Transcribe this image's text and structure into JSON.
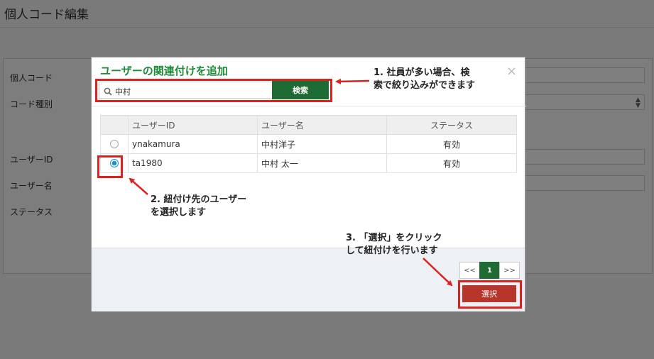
{
  "background": {
    "page_title": "個人コード編集",
    "labels": {
      "personal_code": "個人コード",
      "code_type": "コード種別",
      "user_id": "ユーザーID",
      "user_name": "ユーザー名",
      "status": "ステータス"
    }
  },
  "modal": {
    "title": "ユーザーの関連付けを追加",
    "close": "×",
    "search": {
      "value": "中村",
      "button_label": "検索"
    },
    "table": {
      "headers": [
        "",
        "ユーザーID",
        "ユーザー名",
        "ステータス"
      ],
      "rows": [
        {
          "user_id": "ynakamura",
          "user_name": "中村洋子",
          "status": "有効",
          "selected": false
        },
        {
          "user_id": "ta1980",
          "user_name": "中村 太一",
          "status": "有効",
          "selected": true
        }
      ]
    },
    "pager": {
      "prev": "<<",
      "current": "1",
      "next": ">>"
    },
    "select_button": "選択"
  },
  "annotations": {
    "note1_line1": "1. 社員が多い場合、検",
    "note1_line2": "索で絞り込みができます",
    "note2_line1": "2. 紐付け先のユーザー",
    "note2_line2": "を選択します",
    "note3_line1": "3. 「選択」をクリック",
    "note3_line2": "して紐付けを行います"
  },
  "colors": {
    "highlight": "#e0201c",
    "brand_green": "#1e6b33",
    "select_red": "#b8352b"
  }
}
